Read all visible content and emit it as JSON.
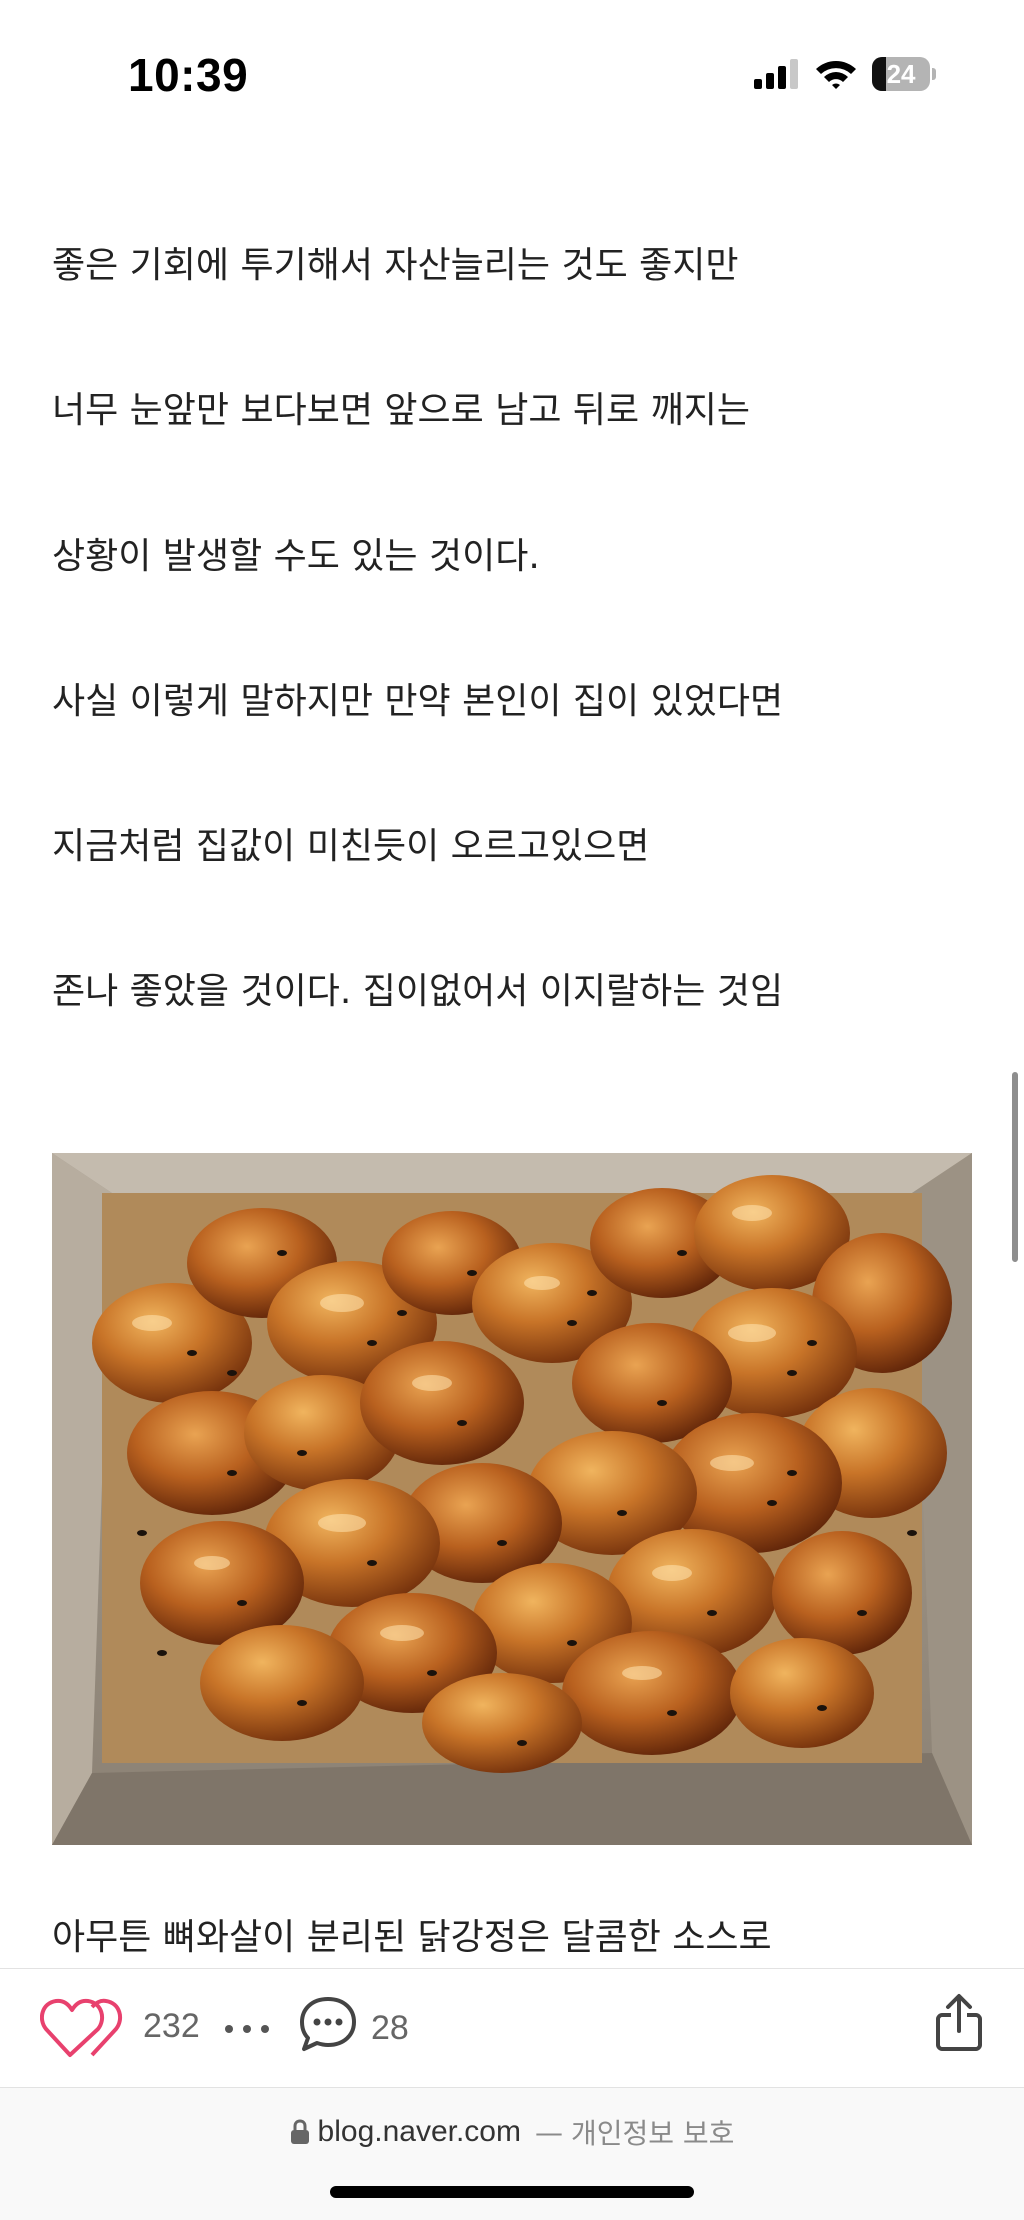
{
  "status_bar": {
    "time": "10:39",
    "battery_level": "24",
    "battery_fraction": 0.24,
    "icons": [
      "cellular-signal-icon",
      "wifi-icon",
      "battery-icon"
    ]
  },
  "article": {
    "paragraphs": [
      "좋은 기회에 투기해서 자산늘리는 것도 좋지만",
      "너무 눈앞만 보다보면 앞으로 남고 뒤로 깨지는",
      "상황이 발생할 수도 있는 것이다.",
      "사실 이렇게 말하지만 만약 본인이 집이 있었다면",
      "지금처럼 집값이 미친듯이 오르고있으면",
      "존나 좋았을 것이다. 집이없어서 이지랄하는 것임",
      "아무튼 뼈와살이 분리된 닭강정은 달콤한 소스로"
    ],
    "image": "photo of glazed Korean fried chicken (dakgangjeong) with black sesame in a paper tray"
  },
  "action_bar": {
    "like_count": "232",
    "comment_count": "28",
    "icons": [
      "heart-icon",
      "more-dots-icon",
      "comment-bubble-icon",
      "share-icon"
    ],
    "accent_color": "#e8416e"
  },
  "browser": {
    "url": "blog.naver.com",
    "separator": "—",
    "privacy_note": "개인정보 보호"
  }
}
